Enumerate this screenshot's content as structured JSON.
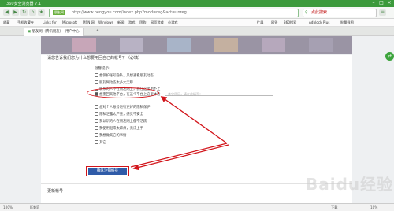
{
  "window": {
    "title": "360安全浏览器 7.1"
  },
  "nav": {
    "badge": "朋友网",
    "url": "http://www.pengyou.com/index.php?mod=reg&act=unreg",
    "search": "点此搜索"
  },
  "bookmarks": [
    "收藏",
    "手机收藏夹",
    "Links for",
    "Microsoft",
    "MSN 网",
    "Windows",
    "新闻",
    "游戏",
    "团购",
    "网页游戏",
    "小游戏",
    "扩展",
    "网银",
    "360搜索",
    "Adblock Plus",
    "批量截图"
  ],
  "tabs": {
    "active": "朋友网（腾讯朋友）- 用户中心",
    "new": "+"
  },
  "page": {
    "question": "请您告诉我们您为什么想要用回自己的帐号？（必填）",
    "tip": "温馨提示：",
    "options": [
      "想保护账号隐私，只想查看朋友动态",
      "朋友网动态太多太无聊",
      "联系的人不在朋友网上，我在这里用不上",
      "想重回其他平台，在这个平台上这里体验",
      "想对个人账号进行更好的隐私保护",
      "隐私泄露太严重，感觉不安全",
      "我认识的人在朋友网上都不活跃",
      "我使用起来太麻烦，无法上手",
      "我想做其它的事情",
      "其它"
    ],
    "other_placeholder": "其它原因，请在此填写：",
    "submit": "确认注销帐号",
    "section_title": "更新帐号"
  },
  "status": {
    "zoom": "100%",
    "ie": "IE兼容",
    "download": "下载",
    "speed": "10%"
  },
  "watermark": "Baidu经验",
  "colors": {
    "accent": "#3c9a3c",
    "annotation": "#d2141a",
    "button": "#2f5ba8"
  }
}
